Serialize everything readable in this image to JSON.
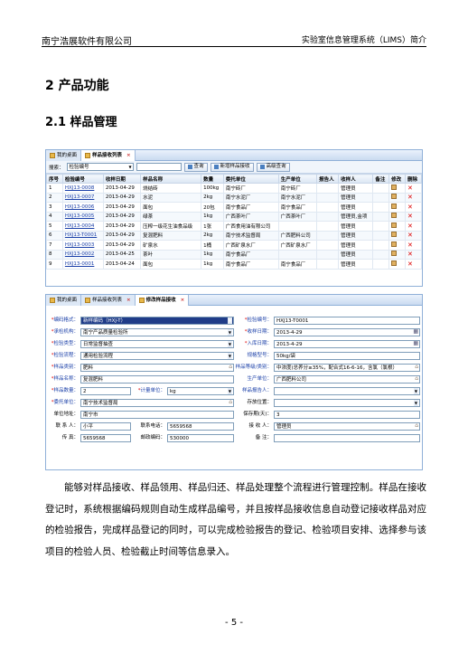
{
  "header": {
    "company": "南宁浩展软件有限公司",
    "title": "实验室信息管理系统（LIMS）简介"
  },
  "section": {
    "h2": "2 产品功能",
    "h3": "2.1 样品管理"
  },
  "win1": {
    "tabs": [
      {
        "label": "我的桌面"
      },
      {
        "label": "样品接收列表"
      }
    ],
    "search_label": "搜索：",
    "search_select": "检验编号",
    "buttons": [
      "查询",
      "新增样品接收",
      "高级查询"
    ],
    "columns": [
      "序号",
      "检验编号",
      "收样日期",
      "样品名称",
      "数量",
      "委托单位",
      "生产单位",
      "报告人",
      "收样人",
      "备注",
      "修改",
      "删除"
    ],
    "rows": [
      [
        "1",
        "HXJ13-0008",
        "2013-04-29",
        "烧结砖",
        "100kg",
        "南宁砖厂",
        "南宁砖厂",
        "",
        "管理员",
        ""
      ],
      [
        "2",
        "HXJ13-0007",
        "2013-04-29",
        "水泥",
        "2kg",
        "南宁水泥厂",
        "南宁水泥厂",
        "",
        "管理员",
        ""
      ],
      [
        "3",
        "HXJ13-0006",
        "2013-04-29",
        "面包",
        "20包",
        "南宁食品厂",
        "南宁食品厂",
        "",
        "管理员",
        ""
      ],
      [
        "4",
        "HXJ13-0005",
        "2013-04-29",
        "绿茶",
        "1kg",
        "广西茶叶厂",
        "广西茶叶厂",
        "",
        "管理员,金项",
        ""
      ],
      [
        "5",
        "HXJ13-0004",
        "2013-04-29",
        "压榨一级花生油食品级",
        "1张",
        "广西食用油有限公司",
        "",
        "",
        "管理员",
        ""
      ],
      [
        "6",
        "HXJ13-T0001",
        "2013-04-29",
        "复混肥料",
        "2kg",
        "南宁技术监督局",
        "广西肥料公司",
        "",
        "管理员",
        ""
      ],
      [
        "7",
        "HXJ13-0003",
        "2013-04-29",
        "矿泉水",
        "1桶",
        "广西矿泉水厂",
        "广西矿泉水厂",
        "",
        "管理员",
        ""
      ],
      [
        "8",
        "HXJ13-0002",
        "2013-04-25",
        "茶叶",
        "1kg",
        "南宁食品厂",
        "",
        "",
        "管理员",
        ""
      ],
      [
        "9",
        "HXJ13-0001",
        "2013-04-24",
        "面包",
        "1kg",
        "南宁食品厂",
        "南宁食品厂",
        "",
        "管理员",
        ""
      ]
    ]
  },
  "win2": {
    "tabs": [
      {
        "label": "我的桌面"
      },
      {
        "label": "样品接收列表"
      },
      {
        "label": "修改样品接收"
      }
    ],
    "fields": {
      "bianma_label": "编码格式：",
      "bianma": "新样编码（HXJ-T）",
      "jianyan_label": "检验编号：",
      "jianyan": "HXJ13-T0001",
      "chengjian_label": "承检机构：",
      "chengjian": "南宁产品质量检验所",
      "shouyang_label": "收样日期：",
      "shouyang": "2013-4-29",
      "leixing_label": "检验类型：",
      "leixing": "日常监督抽查",
      "ruku_label": "入库日期：",
      "ruku": "2013-4-29",
      "liucheng_label": "检验流程：",
      "liucheng": "通用检验流程",
      "guige_label": "规格型号：",
      "guige": "50kg/袋",
      "leibie_label": "样品类别：",
      "leibie": "肥料",
      "dengji_label": "样品等级/类别：",
      "dengji": "中浓度(总养分≥35%，配合式16-6-16，含氯（氯根）",
      "mingcheng_label": "样品名称：",
      "mingcheng": "复混肥料",
      "shengchan_label": "生产单位：",
      "shengchan": "广西肥料公司",
      "shuliang_label": "样品数量：",
      "shuliang": "2",
      "jiliang_label": "计量单位：",
      "jiliang": "kg",
      "baogao_label": "样品报告人：",
      "baogao": "",
      "weituo_label": "委托单位：",
      "weituo": "南宁技术监督局",
      "cunfang_label": "存放位置：",
      "cunfang": "",
      "dizhi_label": "单位地址：",
      "dizhi": "南宁市",
      "baoxian_label": "保存期(天)：",
      "baoxian": "3",
      "lianxi_label": "联 系 人：",
      "lianxi": "小平",
      "dianhua_label": "联系电话：",
      "dianhua": "5659568",
      "jieshou_label": "接 收 人：",
      "jieshou": "管理员",
      "chuanzhen_label": "传    真：",
      "chuanzhen": "5659568",
      "youbian_label": "邮政编码：",
      "youbian": "530000",
      "beizhu_label": "备    注：",
      "beizhu": ""
    }
  },
  "paragraph": "能够对样品接收、样品领用、样品归还、样品处理整个流程进行管理控制。样品在接收登记时，系统根据编码规则自动生成样品编号，并且按样品接收信息自动登记接收样品对应的检验报告，完成样品登记的同时，可以完成检验报告的登记、检验项目安排、选择参与该项目的检验人员、检验截止时间等信息录入。",
  "page_number": "- 5 -"
}
